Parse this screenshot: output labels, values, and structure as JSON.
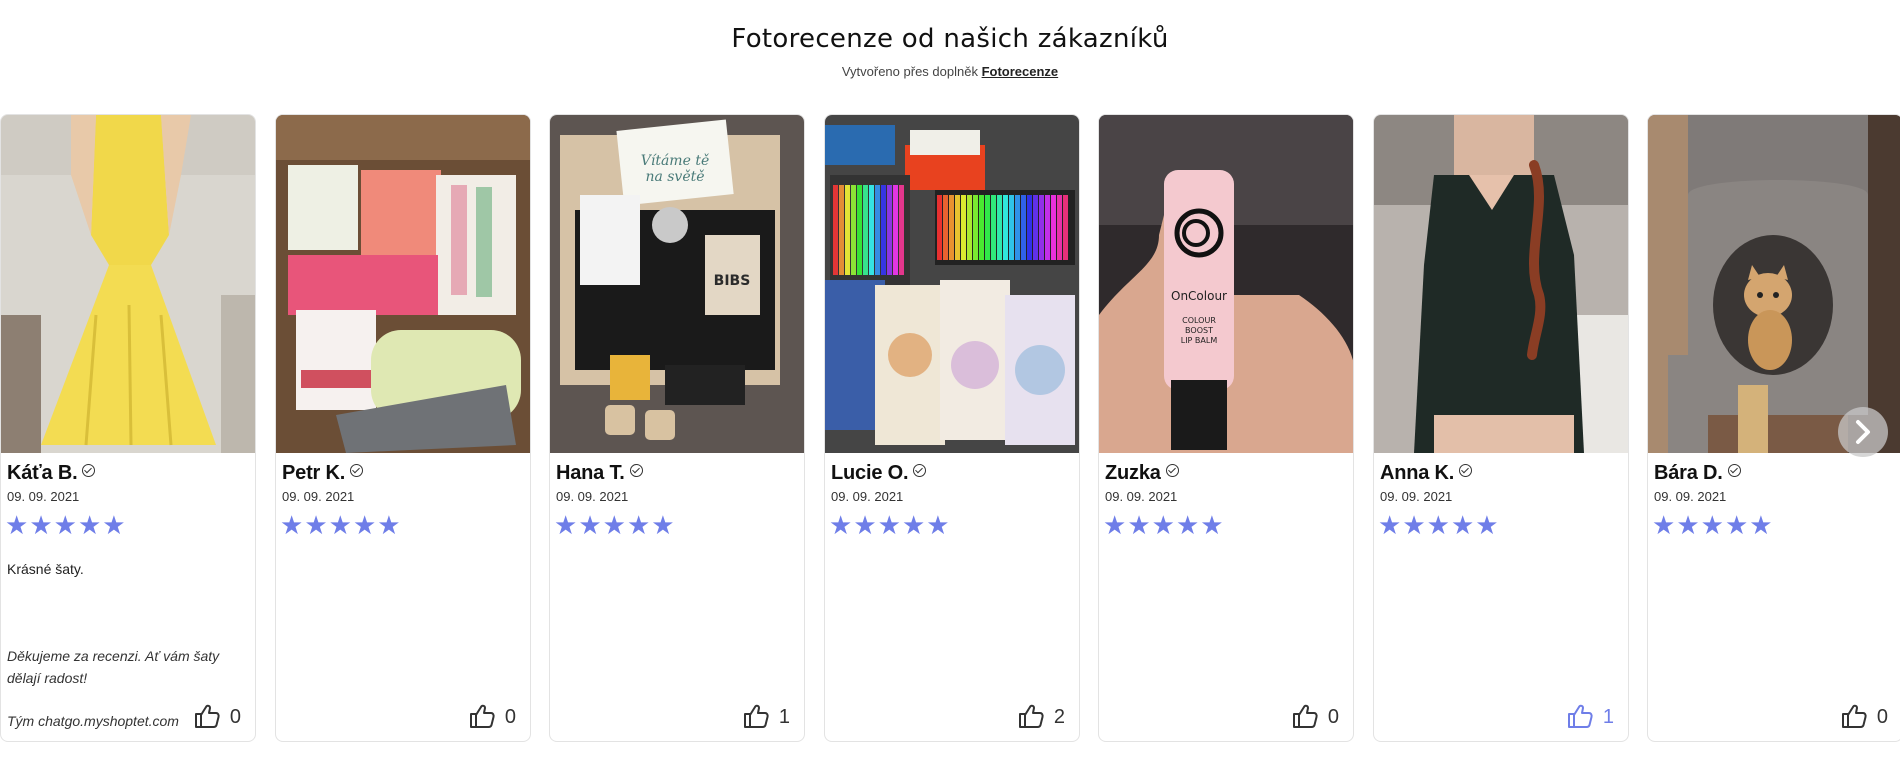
{
  "header": {
    "title": "Fotorecenze od našich zákazníků",
    "subtitle_prefix": "Vytvořeno přes doplněk",
    "subtitle_link": "Fotorecenze"
  },
  "stars_glyph": "★",
  "accent_color": "#6f7ee8",
  "reviews": [
    {
      "name": "Káťa B.",
      "date": "09. 09. 2021",
      "rating": 5,
      "text": "Krásné šaty.",
      "reply": "Děkujeme za recenzi. Ať vám šaty dělají radost!",
      "reply_author": "Tým chatgo.myshoptet.com",
      "likes": "0",
      "liked": false,
      "photo": "yellow-dress"
    },
    {
      "name": "Petr K.",
      "date": "09. 09. 2021",
      "rating": 5,
      "text": "",
      "likes": "0",
      "liked": false,
      "photo": "cosmetics-box"
    },
    {
      "name": "Hana T.",
      "date": "09. 09. 2021",
      "rating": 5,
      "text": "",
      "likes": "1",
      "liked": false,
      "photo": "baby-gift-box"
    },
    {
      "name": "Lucie O.",
      "date": "09. 09. 2021",
      "rating": 5,
      "text": "",
      "likes": "2",
      "liked": false,
      "photo": "coloring-books"
    },
    {
      "name": "Zuzka",
      "date": "09. 09. 2021",
      "rating": 5,
      "text": "",
      "likes": "0",
      "liked": false,
      "photo": "lip-balm",
      "photo_text": [
        "OnColour",
        "COLOUR",
        "BOOST",
        "LIP BALM"
      ]
    },
    {
      "name": "Anna K.",
      "date": "09. 09. 2021",
      "rating": 5,
      "text": "",
      "likes": "1",
      "liked": true,
      "photo": "black-dress"
    },
    {
      "name": "Bára D.",
      "date": "09. 09. 2021",
      "rating": 5,
      "text": "",
      "likes": "0",
      "liked": false,
      "photo": "cat-tree"
    }
  ]
}
